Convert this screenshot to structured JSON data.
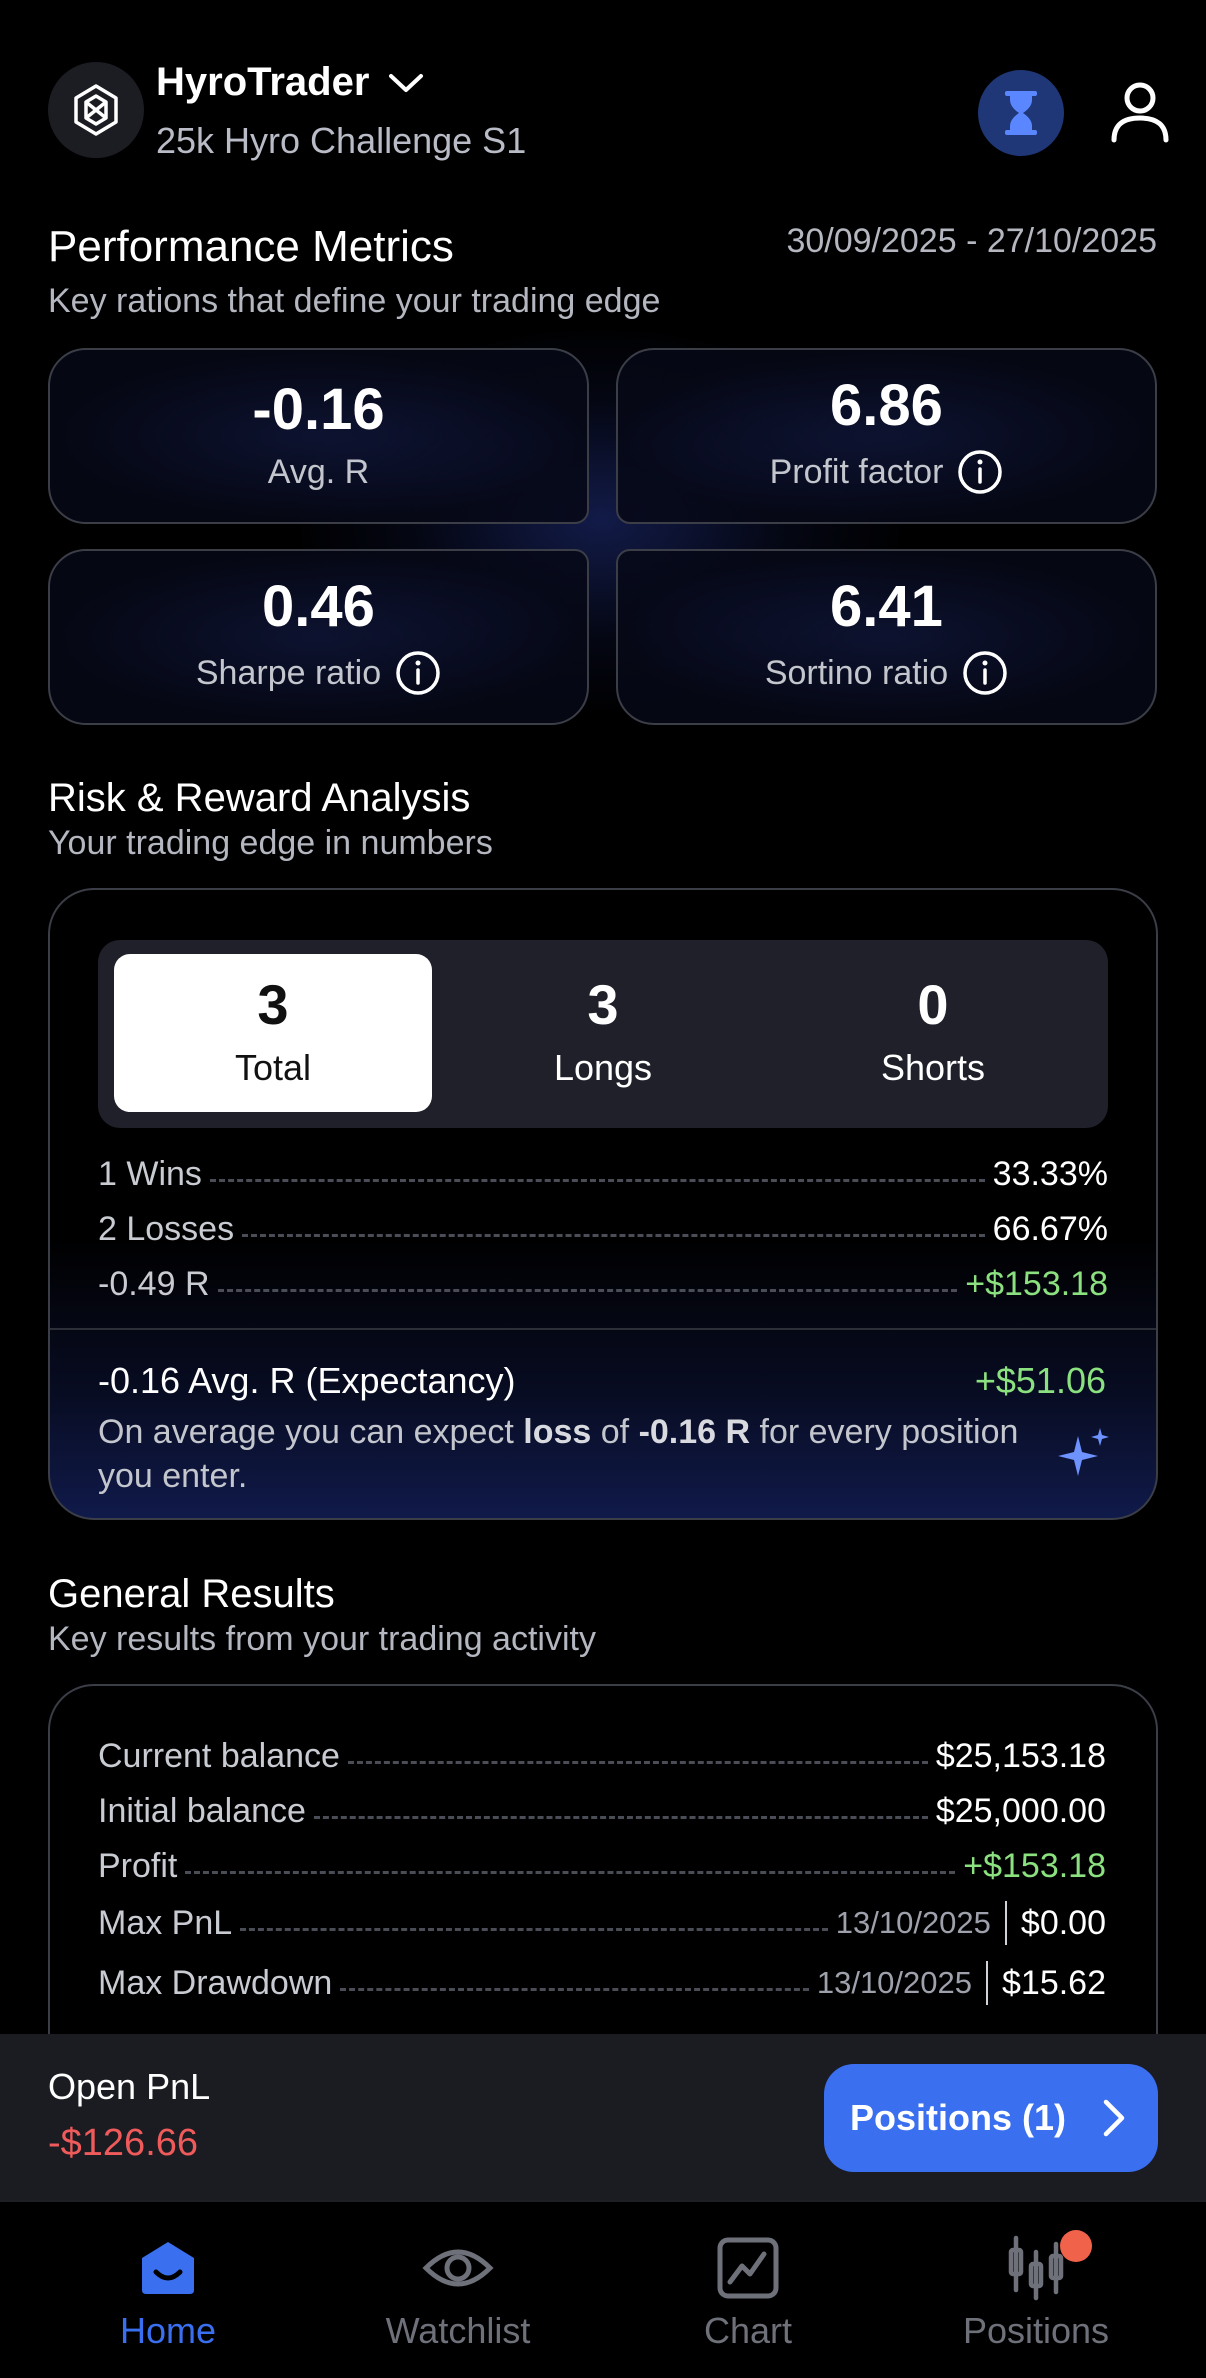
{
  "header": {
    "account_name": "HyroTrader",
    "account_sub": "25k Hyro Challenge S1"
  },
  "performance": {
    "title": "Performance Metrics",
    "subtitle": "Key rations that define your trading edge",
    "date_range": "30/09/2025 - 27/10/2025",
    "metrics": [
      {
        "value": "-0.16",
        "label": "Avg. R"
      },
      {
        "value": "6.86",
        "label": "Profit factor"
      },
      {
        "value": "0.46",
        "label": "Sharpe ratio"
      },
      {
        "value": "6.41",
        "label": "Sortino ratio"
      }
    ]
  },
  "risk": {
    "title": "Risk & Reward Analysis",
    "subtitle": "Your trading edge in numbers",
    "segments": [
      {
        "value": "3",
        "label": "Total"
      },
      {
        "value": "3",
        "label": "Longs"
      },
      {
        "value": "0",
        "label": "Shorts"
      }
    ],
    "rows": [
      {
        "label": "1 Wins",
        "value": "33.33%"
      },
      {
        "label": "2 Losses",
        "value": "66.67%"
      },
      {
        "label": "-0.49 R",
        "value": "+$153.18"
      }
    ],
    "expectancy_title": "-0.16 Avg. R (Expectancy)",
    "expectancy_value": "+$51.06",
    "exp_text_1": "On average you can expect ",
    "exp_text_bold1": "loss",
    "exp_text_2": " of ",
    "exp_text_bold2": "-0.16 R",
    "exp_text_3": " for every position you enter."
  },
  "general": {
    "title": "General Results",
    "subtitle": "Key results from your trading activity",
    "rows": [
      {
        "label": "Current balance",
        "value": "$25,153.18"
      },
      {
        "label": "Initial balance",
        "value": "$25,000.00"
      },
      {
        "label": "Profit",
        "value": "+$153.18"
      },
      {
        "label": "Max PnL",
        "date": "13/10/2025",
        "value": "$0.00"
      },
      {
        "label": "Max Drawdown",
        "date": "13/10/2025",
        "value": "$15.62"
      }
    ]
  },
  "pnl_bar": {
    "label": "Open PnL",
    "value": "-$126.66",
    "button": "Positions (1)"
  },
  "tabs": [
    {
      "label": "Home"
    },
    {
      "label": "Watchlist"
    },
    {
      "label": "Chart"
    },
    {
      "label": "Positions"
    }
  ],
  "colors": {
    "accent": "#3a6ff0",
    "positive": "#8be07f",
    "negative": "#ef5b5b",
    "badge": "#f0624a"
  }
}
